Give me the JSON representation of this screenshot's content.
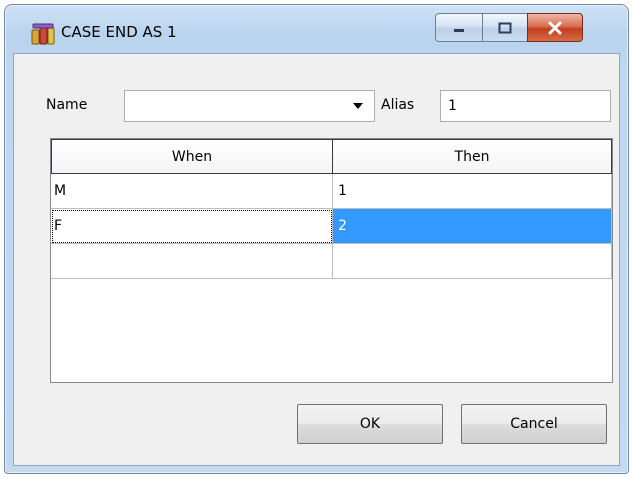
{
  "window": {
    "title": "CASE END AS 1",
    "icon": "database-fields-icon",
    "controls": [
      "minimize-icon",
      "maximize-icon",
      "close-icon"
    ]
  },
  "form": {
    "name_label": "Name",
    "name_value": "",
    "alias_label": "Alias",
    "alias_value": "1"
  },
  "grid": {
    "columns": [
      "When",
      "Then"
    ],
    "rows": [
      {
        "when": "M",
        "then": "1"
      },
      {
        "when": "F",
        "then": "2"
      },
      {
        "when": "",
        "then": ""
      }
    ],
    "selected_row": 1,
    "selection_color": "#3399ff"
  },
  "buttons": {
    "ok": "OK",
    "cancel": "Cancel"
  }
}
